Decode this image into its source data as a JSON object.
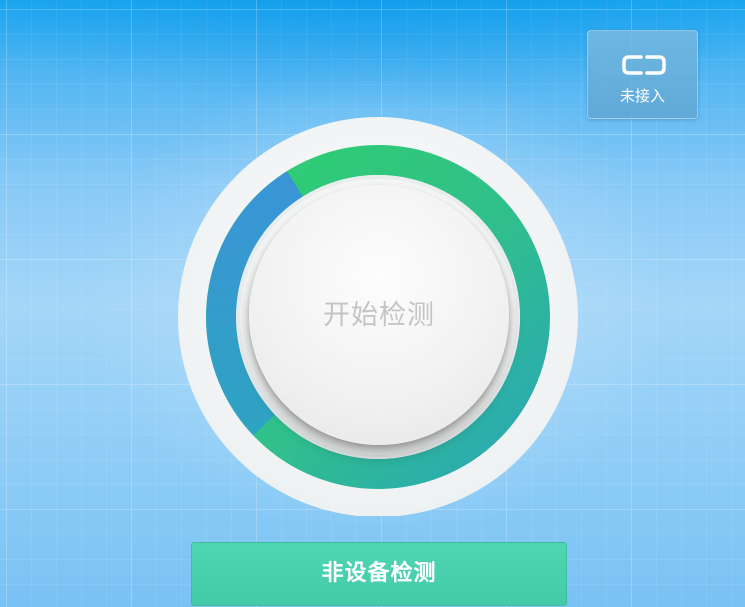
{
  "connection": {
    "icon": "disconnected-plug-icon",
    "status_label": "未接入"
  },
  "dial": {
    "start_label": "开始检测",
    "progress_colors": {
      "blue": "#3a95d6",
      "green": "#2ecf73",
      "teal": "#2db3a6"
    }
  },
  "bottom": {
    "non_device_label": "非设备检测",
    "color": "#48d0ad"
  }
}
